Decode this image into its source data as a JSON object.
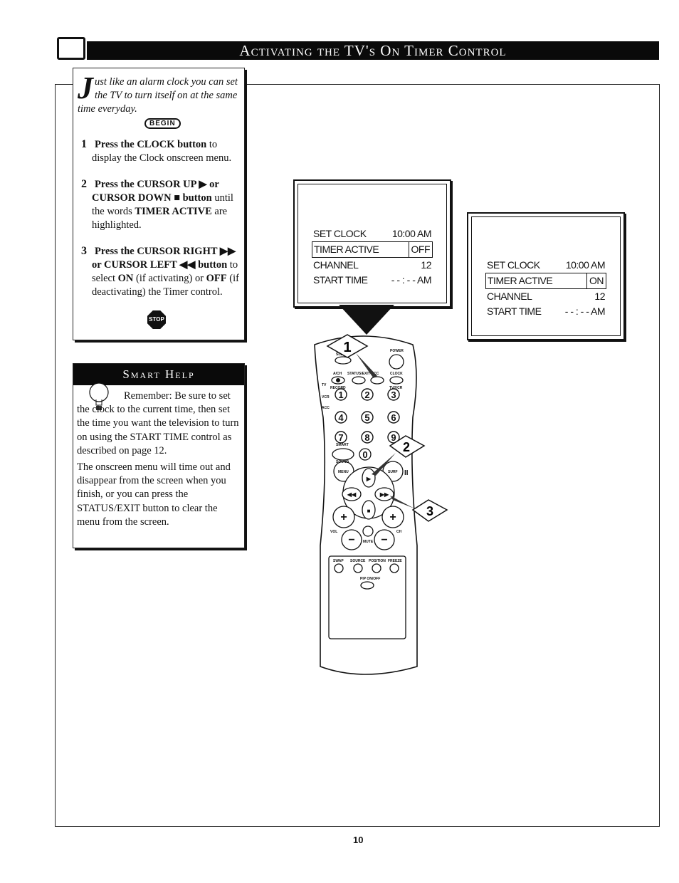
{
  "header": {
    "title": "Activating the TV's On Timer Control"
  },
  "intro": {
    "dropcap": "J",
    "lead": "ust like an alarm clock you can set the TV to turn itself on at the same time everyday.",
    "begin_label": "BEGIN",
    "steps": [
      {
        "num": "1",
        "bold": "Press the CLOCK button",
        "rest": " to display the Clock onscreen menu."
      },
      {
        "num": "2",
        "bold": "Press the CURSOR UP ▶ or CURSOR DOWN ■ button",
        "rest": " until the words ",
        "bold2": "TIMER ACTIVE",
        "rest2": " are highlighted."
      },
      {
        "num": "3",
        "bold": "Press the CURSOR RIGHT ▶▶ or CURSOR LEFT ◀◀ button",
        "rest": " to select ",
        "bold2": "ON",
        "rest2": " (if activating) or ",
        "bold3": "OFF",
        "rest3": " (if deactivating) the Timer control."
      }
    ],
    "stop_label": "STOP"
  },
  "smart_help": {
    "title": "Smart Help",
    "para1": "Remember: Be sure to set the clock to the current time, then set the time you want the television to turn on using the START TIME control as described on page 12.",
    "para2": "The onscreen menu will time out and disappear from the screen when you finish, or you can press the STATUS/EXIT button to clear the menu from the screen."
  },
  "tv_screen_1": {
    "rows": [
      {
        "label": "SET CLOCK",
        "value": "10:00 AM"
      },
      {
        "label": "TIMER ACTIVE",
        "value": "OFF",
        "highlighted": true
      },
      {
        "label": "CHANNEL",
        "value": "12"
      },
      {
        "label": "START TIME",
        "value": "- - : - - AM"
      }
    ]
  },
  "tv_screen_2": {
    "rows": [
      {
        "label": "SET CLOCK",
        "value": "10:00 AM"
      },
      {
        "label": "TIMER ACTIVE",
        "value": "ON",
        "highlighted": true
      },
      {
        "label": "CHANNEL",
        "value": "12"
      },
      {
        "label": "START TIME",
        "value": "- - : - - AM"
      }
    ]
  },
  "remote": {
    "labels": {
      "power": "POWER",
      "sleep": "SLEEP",
      "arch": "A/CH",
      "status": "STATUS/EXIT",
      "cc": "CC",
      "clock": "CLOCK",
      "record": "RECORD",
      "tvvcr": "TV/VCR",
      "tv": "TV",
      "vcr": "VCR",
      "acc": "ACC",
      "smart": "SMART",
      "sound": "SOUND",
      "menu": "MENU",
      "surf": "SURF",
      "vol": "VOL",
      "ch": "CH",
      "mute": "MUTE",
      "swap": "SWAP",
      "source": "SOURCE",
      "position": "POSITION",
      "freeze": "FREEZE",
      "pip": "PIP ON/OFF",
      "pause": "II"
    },
    "digits": [
      "1",
      "2",
      "3",
      "4",
      "5",
      "6",
      "7",
      "8",
      "9",
      "0"
    ],
    "callouts": [
      "1",
      "2",
      "3"
    ]
  },
  "page": {
    "number": "10"
  }
}
